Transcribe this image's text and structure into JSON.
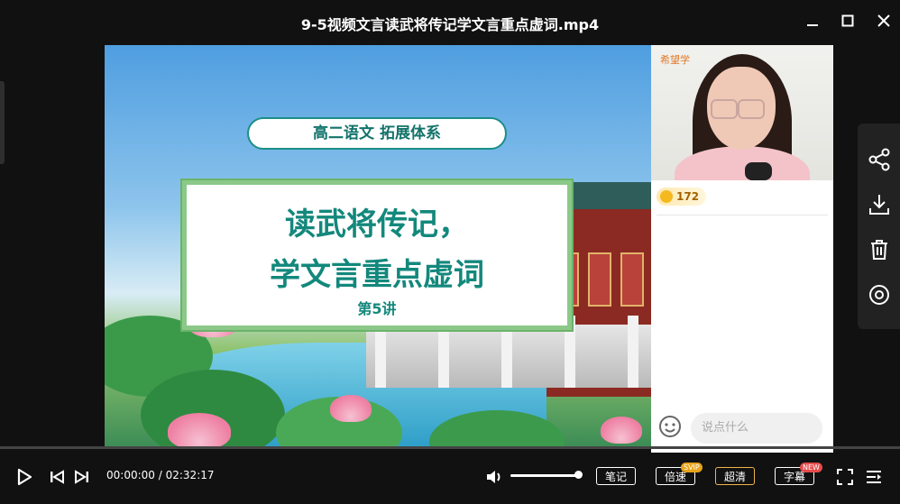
{
  "window": {
    "title": "9-5视频文言读武将传记学文言重点虚词.mp4"
  },
  "slide": {
    "subtitle": "高二语文 拓展体系",
    "title_line1": "读武将传记，",
    "title_line2": "学文言重点虚词",
    "lecture": "第5讲"
  },
  "side_panel": {
    "brand": "希望学",
    "likes": "172",
    "chat_placeholder": "说点什么"
  },
  "player": {
    "current_time": "00:00:00",
    "separator": "/",
    "duration": "02:32:17",
    "notes_label": "笔记",
    "speed_label": "倍速",
    "speed_badge": "SVIP",
    "quality_label": "超清",
    "subtitle_label": "字幕",
    "subtitle_badge": "NEW",
    "progress_fraction": 0,
    "volume_fraction": 1
  },
  "colors": {
    "accent_teal": "#13887c",
    "badge_orange": "#e8a31b",
    "badge_red": "#e54b4b"
  }
}
